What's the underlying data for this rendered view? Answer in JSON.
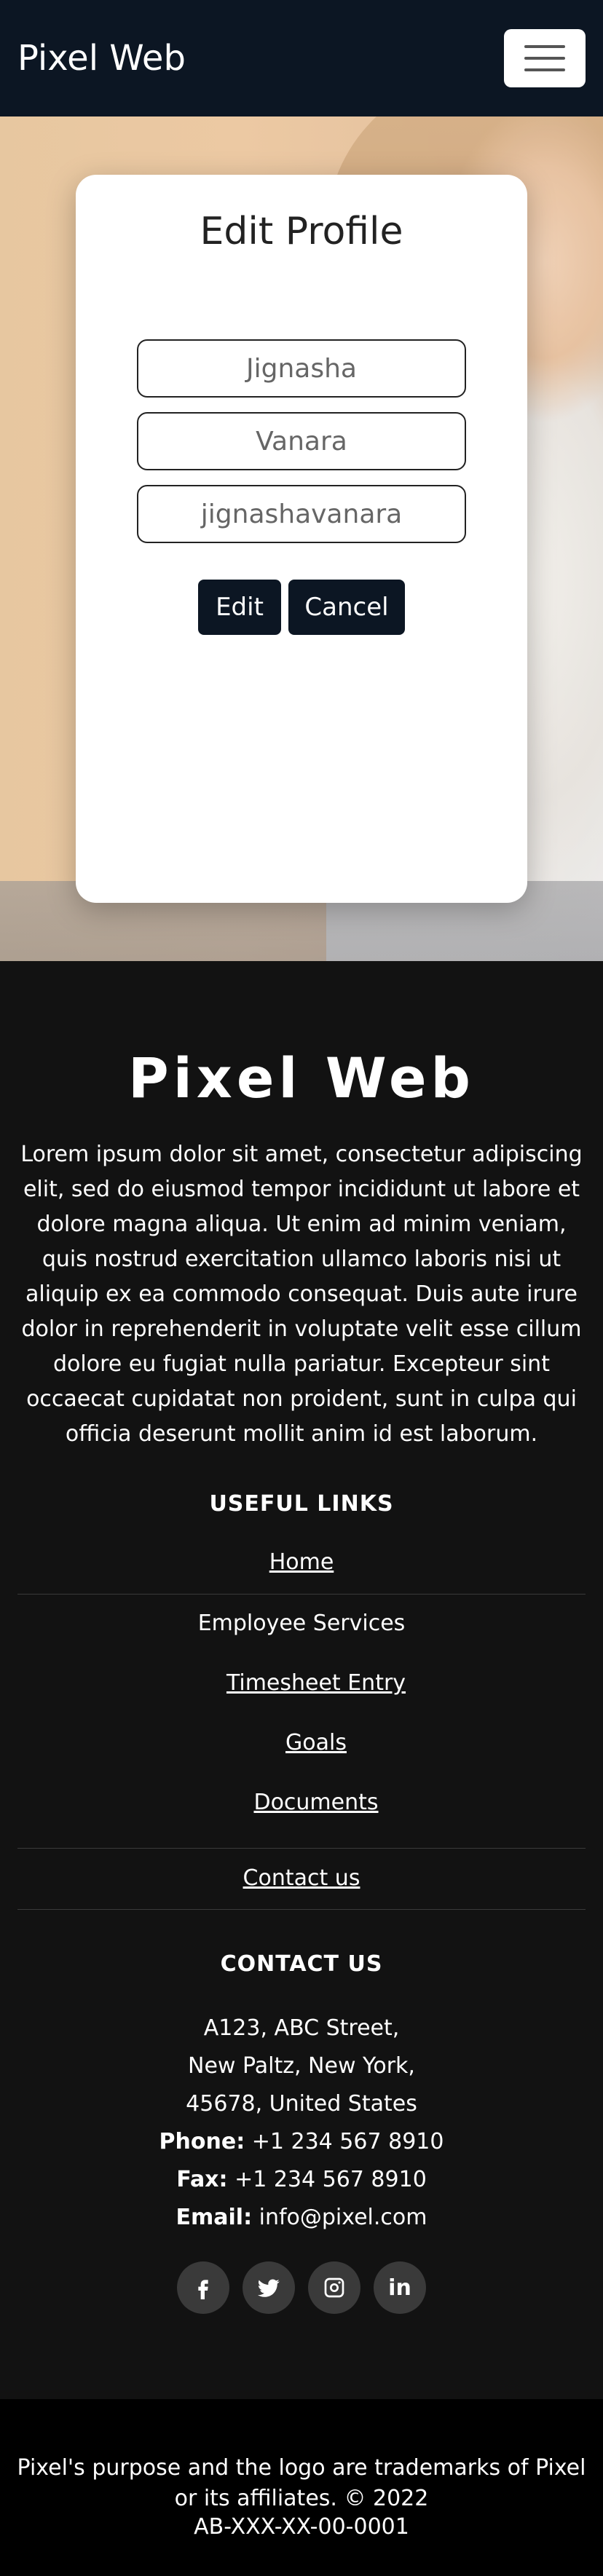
{
  "navbar": {
    "brand": "Pixel Web"
  },
  "profile_form": {
    "title": "Edit Profile",
    "first_name": "Jignasha",
    "last_name": "Vanara",
    "username": "jignashavanara",
    "edit_label": "Edit",
    "cancel_label": "Cancel"
  },
  "footer": {
    "brand": "Pixel Web",
    "description": "Lorem ipsum dolor sit amet, consectetur adipiscing elit, sed do eiusmod tempor incididunt ut labore et dolore magna aliqua. Ut enim ad minim veniam, quis nostrud exercitation ullamco laboris nisi ut aliquip ex ea commodo consequat. Duis aute irure dolor in reprehenderit in voluptate velit esse cillum dolore eu fugiat nulla pariatur. Excepteur sint occaecat cupidatat non proident, sunt in culpa qui officia deserunt mollit anim id est laborum.",
    "useful_links_title": "USEFUL LINKS",
    "links": {
      "home": "Home",
      "employee_services": "Employee Services",
      "timesheet": "Timesheet Entry",
      "goals": "Goals",
      "documents": "Documents",
      "contact": "Contact us"
    },
    "contact_title": "CONTACT US",
    "address": {
      "line1": "A123, ABC Street,",
      "line2": "New Paltz, New York,",
      "line3": "45678, United States"
    },
    "phone_label": "Phone:",
    "phone": "+1 234 567 8910",
    "fax_label": "Fax:",
    "fax": "+1 234 567 8910",
    "email_label": "Email:",
    "email": "info@pixel.com",
    "social_icons": [
      "facebook-icon",
      "twitter-icon",
      "instagram-icon",
      "linkedin-icon"
    ],
    "copyright": "Pixel's purpose and the logo are trademarks of Pixel or its affiliates. © 2022",
    "code": "AB-XXX-XX-00-0001"
  },
  "colors": {
    "navbar_bg": "#0c1623",
    "button_bg": "#0c1623",
    "footer_bg": "#121212",
    "footer_bottom_bg": "#000000"
  }
}
